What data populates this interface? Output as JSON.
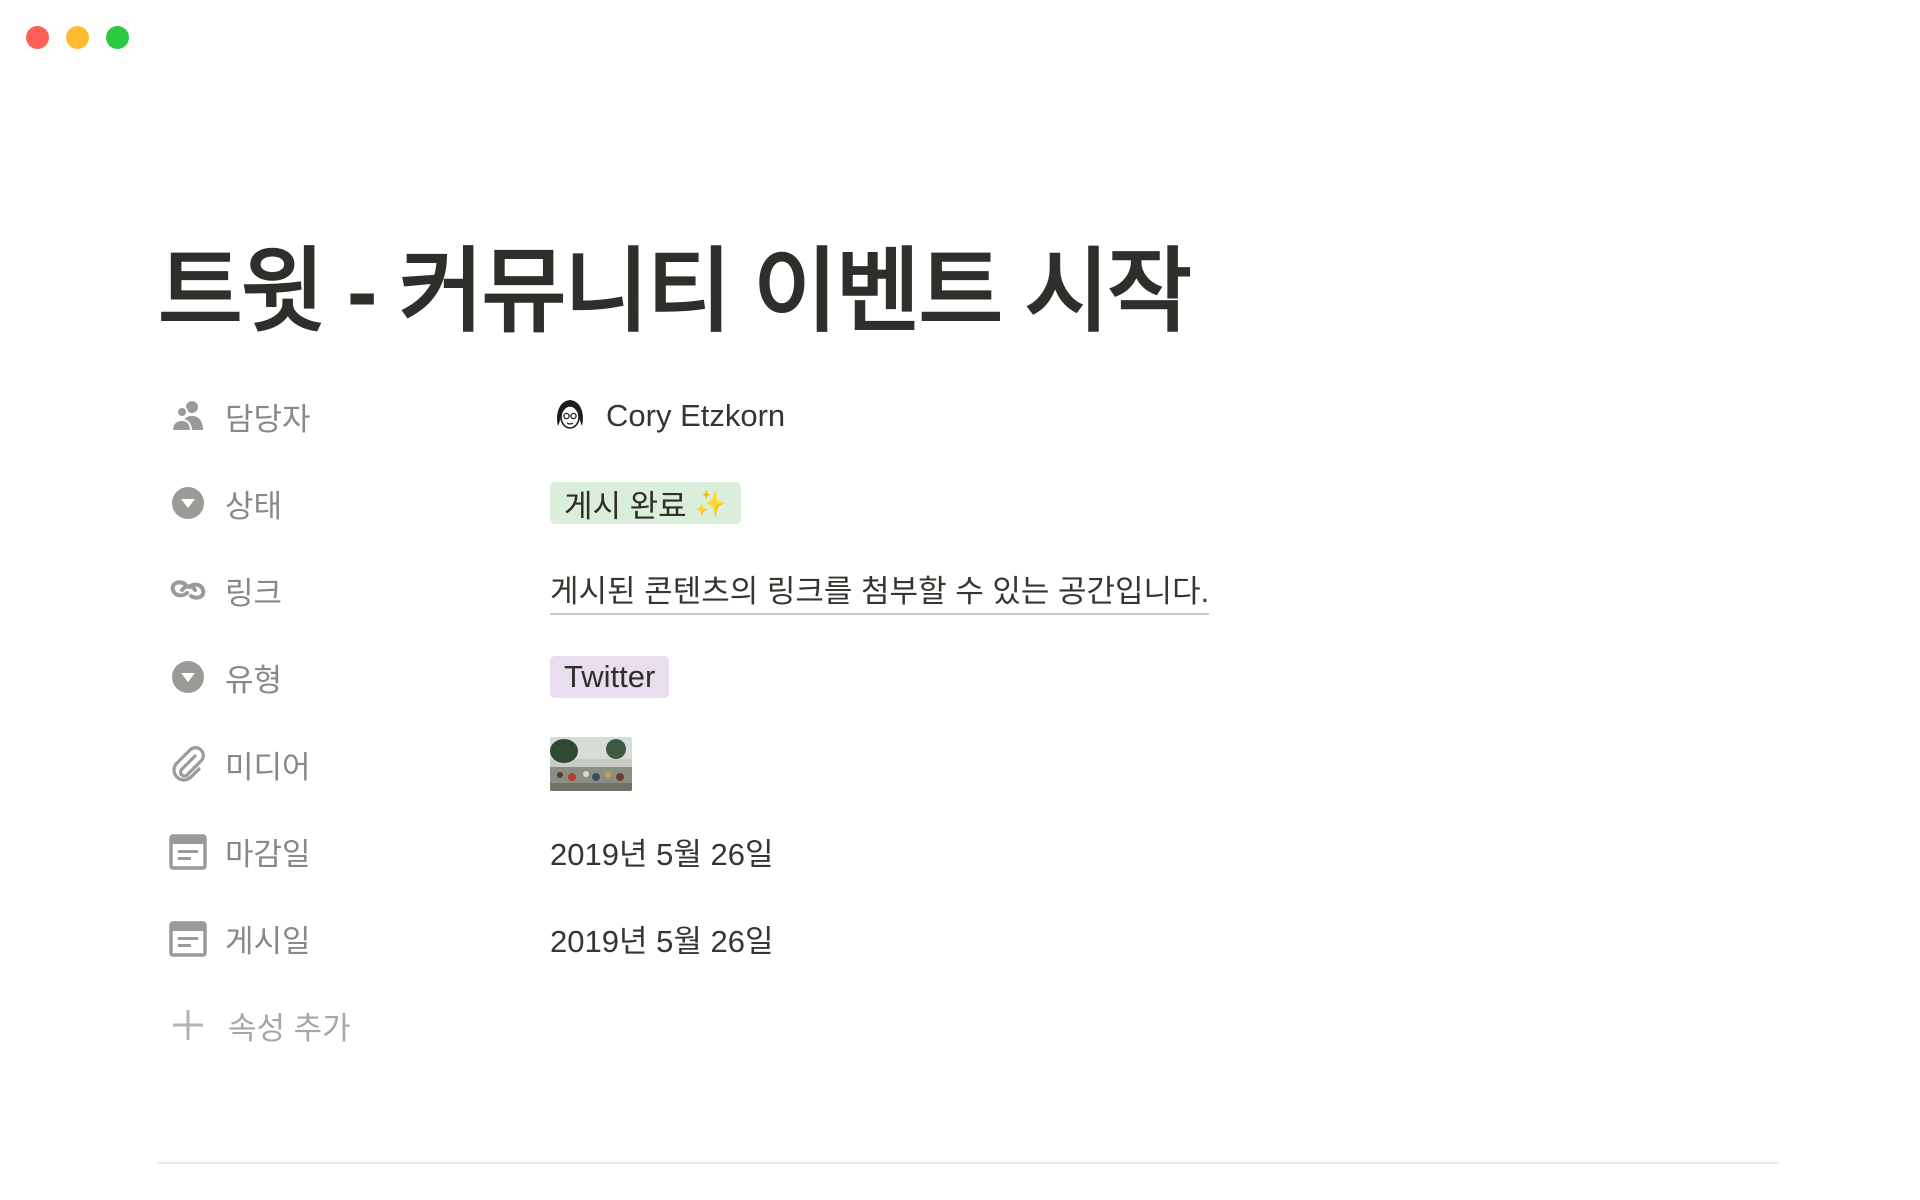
{
  "page": {
    "title": "트윗 - 커뮤니티 이벤트 시작"
  },
  "properties": [
    {
      "name": "담당자",
      "icon": "people-icon",
      "value": "Cory Etzkorn",
      "kind": "person"
    },
    {
      "name": "상태",
      "icon": "select-arrow-icon",
      "value": "게시 완료",
      "emoji": "✨",
      "kind": "status-tag",
      "tag_color": "#dbeddb"
    },
    {
      "name": "링크",
      "icon": "link-icon",
      "value": "게시된 콘텐츠의 링크를 첨부할 수 있는 공간입니다.",
      "kind": "url"
    },
    {
      "name": "유형",
      "icon": "select-arrow-icon",
      "value": "Twitter",
      "kind": "type-tag",
      "tag_color": "#e8deee"
    },
    {
      "name": "미디어",
      "icon": "paperclip-icon",
      "value": "",
      "kind": "media"
    },
    {
      "name": "마감일",
      "icon": "calendar-icon",
      "value": "2019년 5월 26일",
      "kind": "date"
    },
    {
      "name": "게시일",
      "icon": "calendar-icon",
      "value": "2019년 5월 26일",
      "kind": "date"
    }
  ],
  "add_property_label": "속성 추가"
}
